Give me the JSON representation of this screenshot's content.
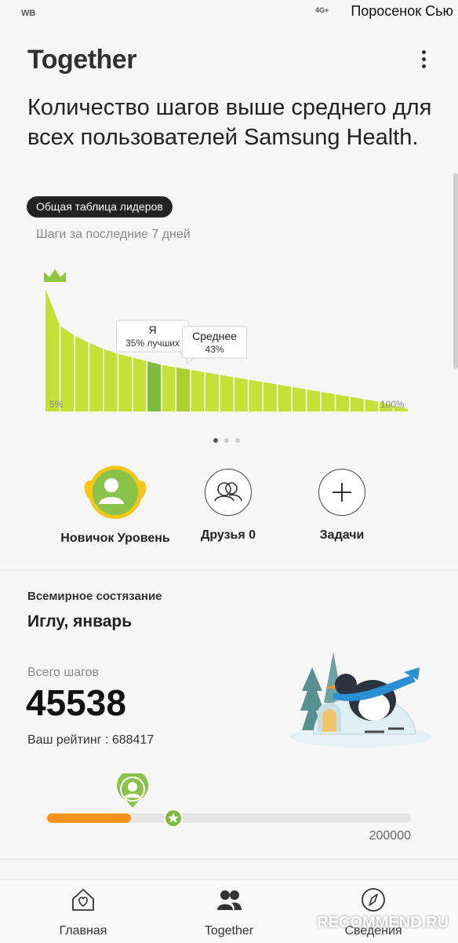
{
  "status_bar": {
    "carrier": "WB",
    "network_badge": "4G+",
    "watermark": "Поросенок Сью"
  },
  "header": {
    "title": "Together",
    "more_icon": "more-vert-icon"
  },
  "headline": "Количество шагов выше среднего для всех пользователей Samsung Health.",
  "leaderboard_chip": "Общая таблица лидеров",
  "chart_subtitle": "Шаги за последние 7 дней",
  "chart_data": {
    "type": "area",
    "title": "Шаги за последние 7 дней",
    "x_labels": {
      "start": "5%",
      "end": "100%"
    },
    "series": [
      {
        "values": [
          100,
          70,
          62,
          56,
          51,
          47,
          44,
          41,
          38,
          36,
          34,
          32,
          30,
          28,
          26,
          24,
          22,
          20,
          18,
          16,
          14,
          12,
          10,
          8,
          5,
          2
        ]
      }
    ],
    "annotations": [
      {
        "title": "Я",
        "subtitle": "35% лучших",
        "bar_index": 7
      },
      {
        "title": "Среднее",
        "subtitle": "43%",
        "bar_index": 9
      }
    ],
    "colors": {
      "main": "#c6e03a",
      "highlight_me": "#7dbb3f",
      "highlight_avg": "#a9cf2e",
      "crown": "#8dc63f"
    }
  },
  "carousel": {
    "pages": 3,
    "active": 1
  },
  "actions": [
    {
      "label": "Новичок Уровень",
      "icon": "level-avatar-icon"
    },
    {
      "label": "Друзья 0",
      "icon": "friends-icon"
    },
    {
      "label": "Задачи",
      "icon": "plus-icon"
    }
  ],
  "contest": {
    "section_label": "Всемирное состязание",
    "name": "Иглу, январь",
    "total_label": "Всего шагов",
    "total_value": "45538",
    "rank_text": "Ваш рейтинг : 688417",
    "goal": "200000",
    "progress_fraction": 0.23,
    "colors": {
      "fill": "#f7941d",
      "track": "#e5e5e5"
    }
  },
  "bottom_nav": [
    {
      "label": "Главная",
      "icon": "home-heart-icon"
    },
    {
      "label": "Together",
      "icon": "people-icon"
    },
    {
      "label": "Сведения",
      "icon": "compass-icon"
    }
  ],
  "bottom_watermark": "RECOMMEND.RU"
}
